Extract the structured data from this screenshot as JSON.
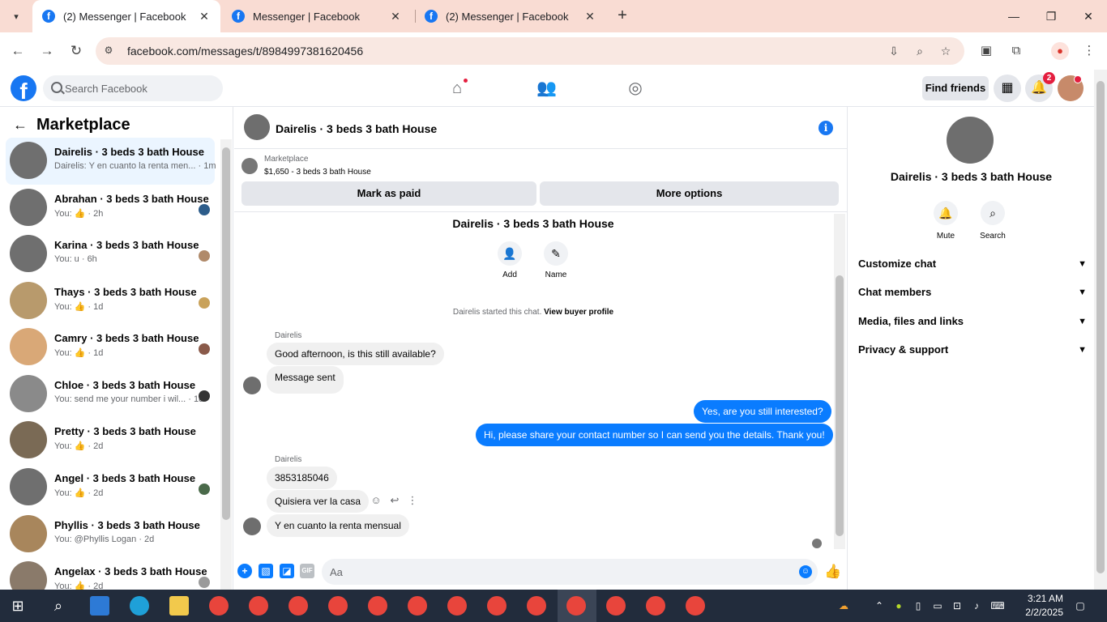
{
  "browser": {
    "tabs": [
      {
        "title": "(2) Messenger | Facebook",
        "active": true
      },
      {
        "title": "Messenger | Facebook",
        "active": false
      },
      {
        "title": "(2) Messenger | Facebook",
        "active": false
      }
    ],
    "url": "facebook.com/messages/t/8984997381620456"
  },
  "fb": {
    "search_placeholder": "Search Facebook",
    "find_friends": "Find friends",
    "notification_count": "2"
  },
  "left": {
    "title": "Marketplace",
    "conversations": [
      {
        "name": "Dairelis · 3 beds 3 bath House",
        "preview": "Dairelis: Y en cuanto la renta men... · 1m",
        "color": "#6f6f6f"
      },
      {
        "name": "Abrahan · 3 beds 3 bath House",
        "preview": "You: 👍 · 2h",
        "color": "#6f6f6f"
      },
      {
        "name": "Karina · 3 beds 3 bath House",
        "preview": "You: u · 6h",
        "color": "#6f6f6f"
      },
      {
        "name": "Thays · 3 beds 3 bath House",
        "preview": "You: 👍 · 1d",
        "color": "#b89a6c"
      },
      {
        "name": "Camry · 3 beds 3 bath House",
        "preview": "You: 👍 · 1d",
        "color": "#d9a877"
      },
      {
        "name": "Chloe · 3 beds 3 bath House",
        "preview": "You: send me your number i wil... · 1d",
        "color": "#8a8a8a"
      },
      {
        "name": "Pretty · 3 beds 3 bath House",
        "preview": "You: 👍 · 2d",
        "color": "#7a6a55"
      },
      {
        "name": "Angel · 3 beds 3 bath House",
        "preview": "You: 👍 · 2d",
        "color": "#6f6f6f"
      },
      {
        "name": "Phyllis · 3 beds 3 bath House",
        "preview": "You: @Phyllis Logan · 2d",
        "color": "#a8865c"
      },
      {
        "name": "Angelax · 3 beds 3 bath House",
        "preview": "You: 👍 · 2d",
        "color": "#8a7a6a"
      }
    ]
  },
  "chat": {
    "title": "Dairelis · 3 beds 3 bath House",
    "listing_source": "Marketplace",
    "listing_price": "$1,650 - 3 beds 3 bath House",
    "mark_paid": "Mark as paid",
    "more_options": "More options",
    "intro_title": "Dairelis · 3 beds 3 bath House",
    "add_label": "Add",
    "name_label": "Name",
    "started_text": "Dairelis started this chat.",
    "view_buyer": "View buyer profile",
    "sender_name": "Dairelis",
    "messages": [
      {
        "text": "Good afternoon, is this still available?",
        "dir": "in"
      },
      {
        "text": "Message sent",
        "dir": "in"
      },
      {
        "text": "Yes, are you still interested?",
        "dir": "out"
      },
      {
        "text": "Hi, please share your contact number so I can send you the details. Thank you!",
        "dir": "out"
      },
      {
        "text": "3853185046",
        "dir": "in"
      },
      {
        "text": "Quisiera ver la casa",
        "dir": "in"
      },
      {
        "text": "Y en cuanto la renta mensual",
        "dir": "in"
      }
    ],
    "composer_placeholder": "Aa"
  },
  "right": {
    "name": "Dairelis · 3 beds 3 bath House",
    "mute": "Mute",
    "search": "Search",
    "rows": [
      "Customize chat",
      "Chat members",
      "Media, files and links",
      "Privacy & support"
    ]
  },
  "taskbar": {
    "time": "3:21 AM",
    "date": "2/2/2025"
  }
}
